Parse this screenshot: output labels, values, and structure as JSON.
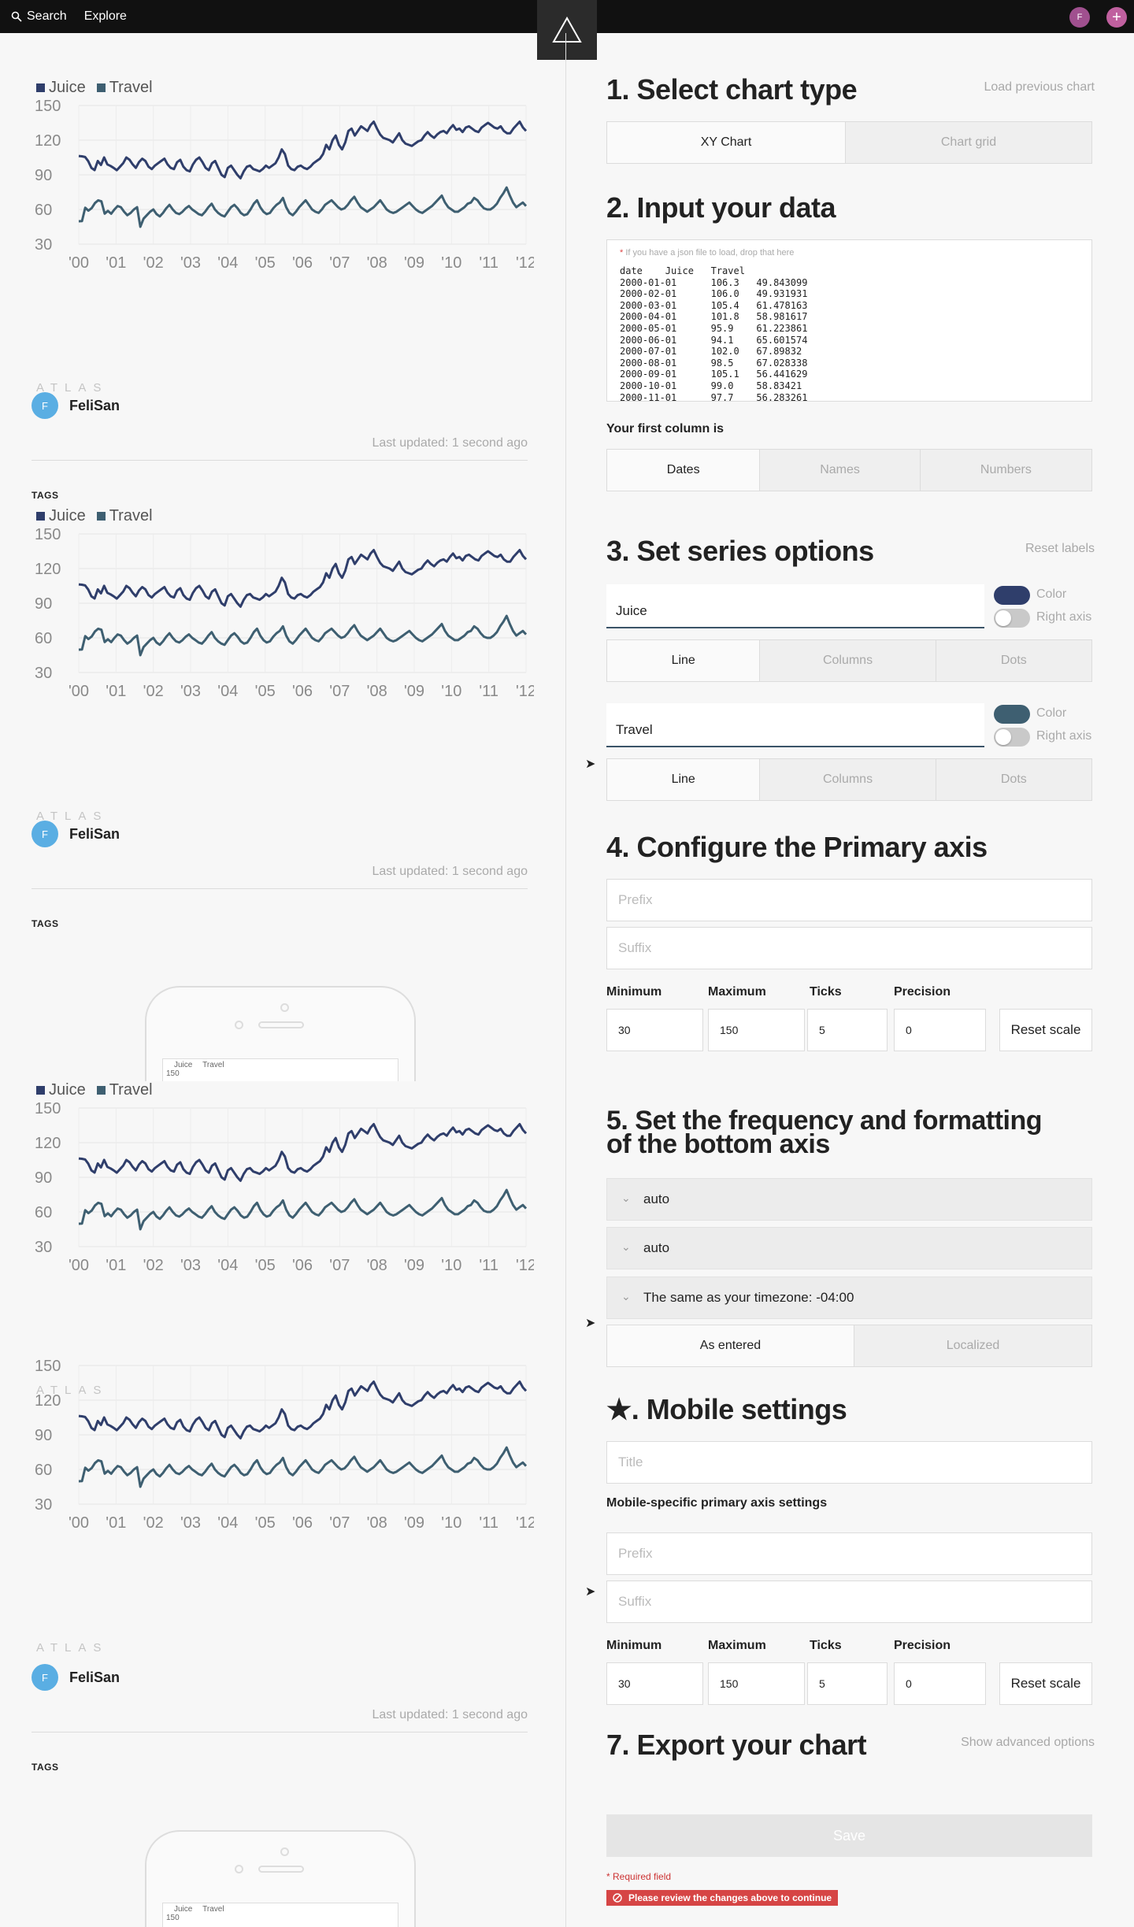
{
  "topbar": {
    "search": "Search",
    "explore": "Explore",
    "user_initial": "F",
    "plus": "+"
  },
  "colors": {
    "juice": "#2f3e6b",
    "travel": "#3e5f71",
    "accent": "#a0508f"
  },
  "preview": {
    "legend": [
      "Juice",
      "Travel"
    ],
    "atlas": "ATLAS",
    "author_initial": "F",
    "author": "FeliSan",
    "updated": "Last updated: 1 second ago",
    "tags": "TAGS",
    "mini_top": "150"
  },
  "chart_data": {
    "type": "line",
    "x_tick_labels": [
      "'00",
      "'01",
      "'02",
      "'03",
      "'04",
      "'05",
      "'06",
      "'07",
      "'08",
      "'09",
      "'10",
      "'11",
      "'12"
    ],
    "y_ticks": [
      150,
      120,
      90,
      60,
      30
    ],
    "ylim": [
      30,
      150
    ],
    "xlim": [
      "2000-01-01",
      "2012-01-01"
    ],
    "series": [
      {
        "name": "Juice",
        "values": [
          106.3,
          106.0,
          105.4,
          101.8,
          95.9,
          94.1,
          102.0,
          98.5,
          105.1,
          99.0,
          97.7,
          96,
          94,
          97,
          100,
          105,
          103,
          99,
          96,
          101,
          104,
          102,
          97,
          95,
          98,
          100,
          102,
          104,
          99,
          96,
          95,
          101,
          103,
          97,
          94,
          93,
          99,
          103,
          105,
          101,
          96,
          94,
          100,
          102,
          96,
          90,
          88,
          96,
          98,
          94,
          90,
          87,
          93,
          97,
          98,
          95,
          94,
          93,
          95,
          98,
          96,
          98,
          100,
          105,
          112,
          108,
          98,
          95,
          94,
          97,
          98,
          96,
          95,
          97,
          100,
          102,
          104,
          108,
          116,
          112,
          120,
          124,
          116,
          112,
          118,
          128,
          130,
          124,
          128,
          132,
          130,
          128,
          133,
          136,
          130,
          125,
          122,
          121,
          120,
          118,
          122,
          126,
          120,
          117,
          116,
          115,
          117,
          119,
          120,
          124,
          127,
          124,
          122,
          125,
          127,
          128,
          126,
          130,
          133,
          129,
          130,
          127,
          131,
          132,
          130,
          128,
          127,
          131,
          133,
          135,
          133,
          131,
          130,
          132,
          128,
          126,
          126,
          130,
          133,
          136,
          131,
          128
        ]
      },
      {
        "name": "Travel",
        "values": [
          49.8,
          49.9,
          61.5,
          59.0,
          61.2,
          65.6,
          67.9,
          67.0,
          56.4,
          58.8,
          56.3,
          60,
          63,
          62,
          58,
          55,
          57,
          60,
          62,
          45,
          52,
          55,
          58,
          60,
          56,
          54,
          57,
          61,
          64,
          60,
          57,
          56,
          58,
          61,
          63,
          60,
          58,
          56,
          55,
          58,
          62,
          65,
          60,
          57,
          55,
          54,
          58,
          62,
          64,
          61,
          57,
          55,
          56,
          60,
          65,
          68,
          62,
          58,
          56,
          57,
          61,
          64,
          66,
          70,
          62,
          57,
          55,
          58,
          62,
          65,
          68,
          64,
          60,
          58,
          57,
          60,
          64,
          66,
          68,
          65,
          62,
          60,
          61,
          64,
          68,
          71,
          66,
          62,
          60,
          58,
          60,
          62,
          65,
          68,
          64,
          60,
          58,
          57,
          58,
          60,
          62,
          64,
          66,
          63,
          60,
          58,
          57,
          59,
          61,
          63,
          66,
          69,
          72,
          66,
          62,
          60,
          58,
          58,
          60,
          62,
          65,
          66,
          70,
          68,
          64,
          61,
          60,
          60,
          62,
          65,
          70,
          74,
          79,
          72,
          66,
          62,
          64,
          66,
          63
        ]
      }
    ]
  },
  "editor": {
    "s1": {
      "title": "1. Select chart type",
      "link": "Load previous chart",
      "options": [
        "XY Chart",
        "Chart grid"
      ]
    },
    "s2": {
      "title": "2. Input your data",
      "hint_star": "*",
      "hint": "If you have a json file to load, drop that here",
      "data_text": "date    Juice   Travel\n2000-01-01      106.3   49.843099\n2000-02-01      106.0   49.931931\n2000-03-01      105.4   61.478163\n2000-04-01      101.8   58.981617\n2000-05-01      95.9    61.223861\n2000-06-01      94.1    65.601574\n2000-07-01      102.0   67.89832\n2000-08-01      98.5    67.028338\n2000-09-01      105.1   56.441629\n2000-10-01      99.0    58.83421\n2000-11-01      97.7    56.283261",
      "first_col_label": "Your first column is",
      "first_col_options": [
        "Dates",
        "Names",
        "Numbers"
      ]
    },
    "s3": {
      "title": "3. Set series options",
      "link": "Reset labels",
      "series": [
        {
          "label": "Juice",
          "color_label": "Color",
          "right_axis_label": "Right axis",
          "types": [
            "Line",
            "Columns",
            "Dots"
          ]
        },
        {
          "label": "Travel",
          "color_label": "Color",
          "right_axis_label": "Right axis",
          "types": [
            "Line",
            "Columns",
            "Dots"
          ]
        }
      ]
    },
    "s4": {
      "title": "4. Configure the Primary axis",
      "prefix_ph": "Prefix",
      "suffix_ph": "Suffix",
      "labels": [
        "Minimum",
        "Maximum",
        "Ticks",
        "Precision"
      ],
      "values": [
        "30",
        "150",
        "5",
        "0"
      ],
      "reset": "Reset scale"
    },
    "s5": {
      "title_line1": "5. Set the frequency and formatting",
      "title_line2": "of the bottom axis",
      "dropdowns": [
        "auto",
        "auto",
        "The same as your timezone: -04:00"
      ],
      "tz_options": [
        "As entered",
        "Localized"
      ]
    },
    "s6": {
      "title": "★. Mobile settings",
      "title_ph": "Title",
      "sub": "Mobile-specific primary axis settings",
      "prefix_ph": "Prefix",
      "suffix_ph": "Suffix",
      "labels": [
        "Minimum",
        "Maximum",
        "Ticks",
        "Precision"
      ],
      "values": [
        "30",
        "150",
        "5",
        "0"
      ],
      "reset": "Reset scale"
    },
    "s7": {
      "title": "7. Export your chart",
      "link": "Show advanced options",
      "save": "Save",
      "required": "* Required field",
      "error": "Please review the changes above to continue"
    }
  }
}
